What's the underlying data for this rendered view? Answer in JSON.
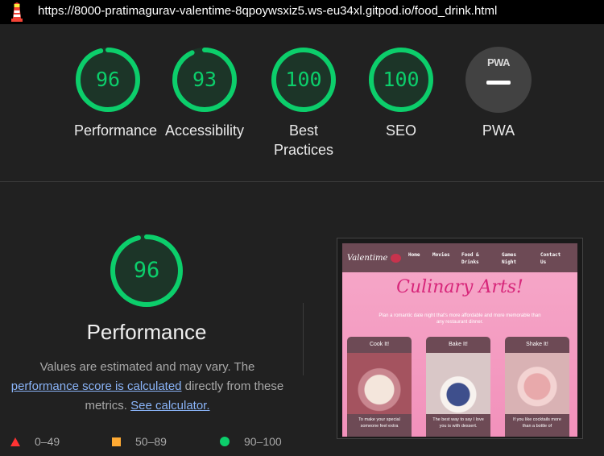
{
  "browser": {
    "url": "https://8000-pratimagurav-valentime-8qpoywsxiz5.ws-eu34xl.gitpod.io/food_drink.html"
  },
  "summary": [
    {
      "label": "Performance",
      "score": "96",
      "value": 96
    },
    {
      "label": "Accessibility",
      "score": "93",
      "value": 93
    },
    {
      "label": "Best Practices",
      "score": "100",
      "value": 100
    },
    {
      "label": "SEO",
      "score": "100",
      "value": 100
    },
    {
      "label": "PWA",
      "badge": "PWA"
    }
  ],
  "detail": {
    "score": "96",
    "value": 96,
    "title": "Performance",
    "desc_part1": "Values are estimated and may vary. The ",
    "link1": "performance score is calculated",
    "desc_part2": " directly from these metrics. ",
    "link2": "See calculator."
  },
  "legend": [
    {
      "range": "0–49",
      "shape": "triangle",
      "color": "#ff3333"
    },
    {
      "range": "50–89",
      "shape": "square",
      "color": "#ffaa33"
    },
    {
      "range": "90–100",
      "shape": "circle",
      "color": "#0cce6b"
    }
  ],
  "thumbnail": {
    "brand": "Valentime",
    "nav": [
      "Home",
      "Movies",
      "Food & Drinks",
      "Games Night",
      "Contact Us"
    ],
    "title": "Culinary Arts!",
    "subtitle": "Plan a romantic date night that's more affordable and more memorable than any restaurant dinner.",
    "cards": [
      {
        "title": "Cook It!",
        "text": "To make your special someone feel extra"
      },
      {
        "title": "Bake It!",
        "text": "The best way to say I love you is with dessert."
      },
      {
        "title": "Shake It!",
        "text": "If you like cocktails more than a bottle of"
      }
    ]
  },
  "colors": {
    "pass": "#0cce6b",
    "average": "#ffaa33",
    "fail": "#ff3333",
    "link": "#8ab4f8",
    "background": "#212121"
  }
}
